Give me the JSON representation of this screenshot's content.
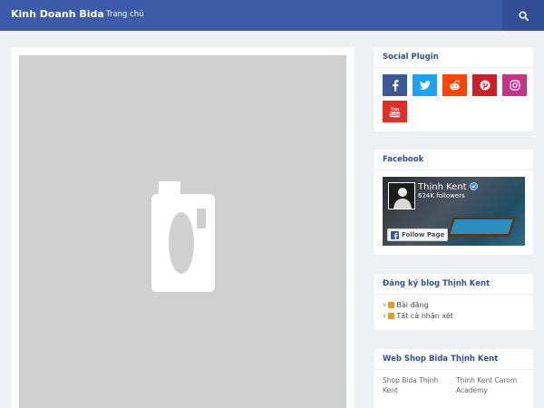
{
  "header": {
    "brand": "Kinh Doanh Bida",
    "nav_home": "Trang chủ"
  },
  "main": {
    "image_icon": "camera-placeholder-icon"
  },
  "social": {
    "title": "Social Plugin",
    "buttons": [
      {
        "icon": "facebook-icon",
        "color": "#3b5998"
      },
      {
        "icon": "twitter-icon",
        "color": "#1da1f2"
      },
      {
        "icon": "reddit-icon",
        "color": "#ff4500"
      },
      {
        "icon": "pinterest-icon",
        "color": "#cb2027"
      },
      {
        "icon": "instagram-icon",
        "color": "#c13584"
      },
      {
        "icon": "youtube-icon",
        "color": "#e52d27",
        "label": "You Tube"
      }
    ]
  },
  "facebook": {
    "title": "Facebook",
    "page_name": "Thịnh Kent",
    "followers": "624K followers",
    "follow_label": "Follow Page"
  },
  "subscribe": {
    "title": "Đăng ký blog Thịnh Kent",
    "items": [
      "Bài đăng",
      "Tất cả nhận xét"
    ]
  },
  "shop": {
    "title": "Web Shop Bida Thịnh Kent",
    "links": [
      "Shop Bida Thịnh Kent",
      "Thinh Kent Carom Academy"
    ]
  },
  "colors": {
    "header": "#3d5ba8",
    "widget_title": "#2f4f8f"
  }
}
